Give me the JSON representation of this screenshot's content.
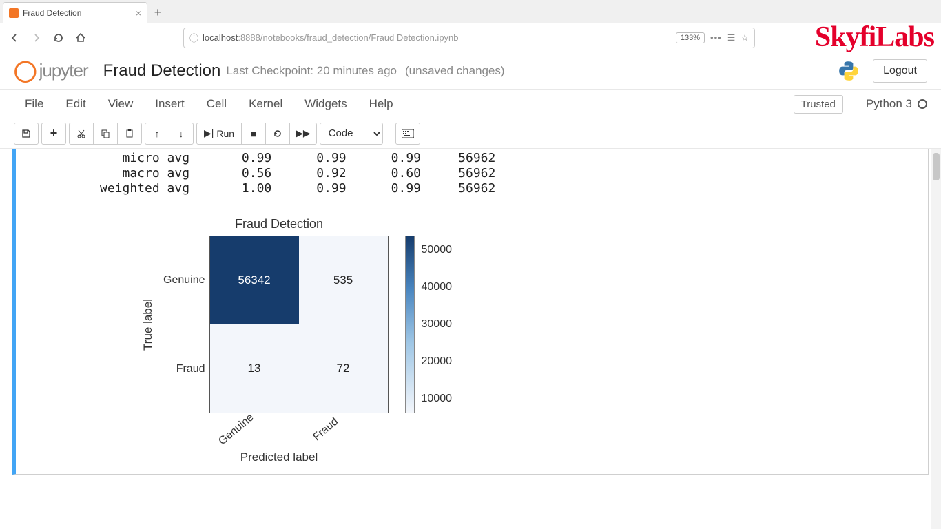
{
  "browser": {
    "tab_title": "Fraud Detection",
    "url_prefix": "localhost",
    "url_port": ":8888",
    "url_path": "/notebooks/fraud_detection/Fraud Detection.ipynb",
    "zoom": "133%"
  },
  "watermark": "SkyfiLabs",
  "header": {
    "logo_text": "jupyter",
    "title": "Fraud Detection",
    "checkpoint": "Last Checkpoint: 20 minutes ago",
    "unsaved": "(unsaved changes)",
    "logout": "Logout"
  },
  "menu": {
    "items": [
      "File",
      "Edit",
      "View",
      "Insert",
      "Cell",
      "Kernel",
      "Widgets",
      "Help"
    ],
    "trusted": "Trusted",
    "kernel": "Python 3"
  },
  "toolbar": {
    "run_label": "Run",
    "cell_type": "Code"
  },
  "output_text": "   micro avg       0.99      0.99      0.99     56962\n   macro avg       0.56      0.92      0.60     56962\nweighted avg       1.00      0.99      0.99     56962",
  "chart_data": {
    "type": "heatmap",
    "title": "Fraud Detection",
    "xlabel": "Predicted label",
    "ylabel": "True label",
    "x_categories": [
      "Genuine",
      "Fraud"
    ],
    "y_categories": [
      "Genuine",
      "Fraud"
    ],
    "values": [
      [
        56342,
        535
      ],
      [
        13,
        72
      ]
    ],
    "colorbar_ticks": [
      "50000",
      "40000",
      "30000",
      "20000",
      "10000"
    ],
    "color_range": [
      0,
      56342
    ]
  }
}
